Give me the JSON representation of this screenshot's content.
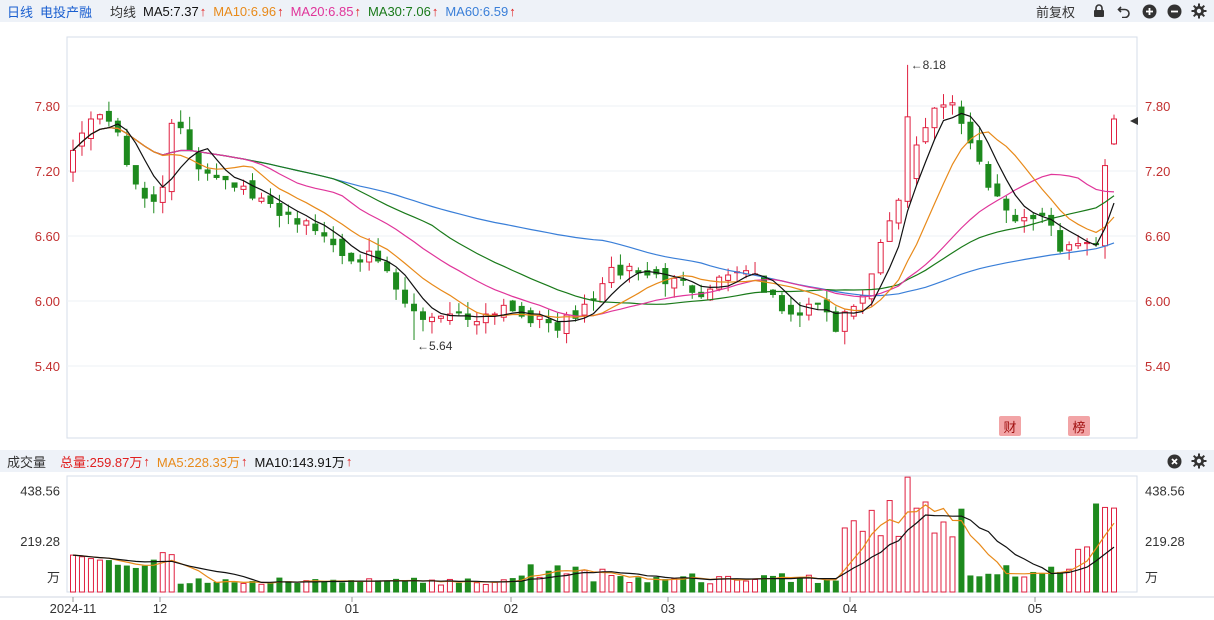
{
  "header": {
    "tabs": [
      {
        "label": "日线",
        "color": "#1a5fd0"
      },
      {
        "label": "电投产融",
        "color": "#1a5fd0"
      },
      {
        "label": "均线",
        "color": "#333333"
      }
    ],
    "ma_items": [
      {
        "label": "MA5:7.37",
        "color": "#111111"
      },
      {
        "label": "MA10:6.96",
        "color": "#e88a1a"
      },
      {
        "label": "MA20:6.85",
        "color": "#e0359a"
      },
      {
        "label": "MA30:7.06",
        "color": "#1a7a1a"
      },
      {
        "label": "MA60:6.59",
        "color": "#3a7fd8"
      }
    ],
    "adjust_label": "前复权"
  },
  "volume_header": {
    "title": "成交量",
    "items": [
      {
        "label": "总量:259.87万",
        "color": "#e02020"
      },
      {
        "label": "MA5:228.33万",
        "color": "#e88a1a"
      },
      {
        "label": "MA10:143.91万",
        "color": "#111111"
      }
    ]
  },
  "badges": [
    {
      "label": "财"
    },
    {
      "label": "榜"
    }
  ],
  "chart_data": [
    {
      "type": "candlestick",
      "ylim": [
        5.0,
        8.3
      ],
      "y_ticks": [
        "7.80",
        "7.20",
        "6.60",
        "6.00",
        "5.40"
      ],
      "y_tick_values": [
        7.8,
        7.2,
        6.6,
        6.0,
        5.4
      ],
      "annotations": [
        {
          "text": "←8.18",
          "value": 8.18
        },
        {
          "text": "←5.64",
          "value": 5.64
        }
      ],
      "colors": {
        "up": "#e02040",
        "down": "#1e8a1e",
        "ma5": "#111111",
        "ma10": "#e88a1a",
        "ma20": "#e0359a",
        "ma30": "#1a7a1a",
        "ma60": "#3a7fd8"
      }
    },
    {
      "type": "bar",
      "y_ticks": [
        "438.56",
        "219.28",
        "万"
      ],
      "y_tick_values": [
        438.56,
        219.28,
        0
      ],
      "x_ticks": [
        "2024-11",
        "12",
        "01",
        "02",
        "03",
        "04",
        "05"
      ]
    }
  ]
}
